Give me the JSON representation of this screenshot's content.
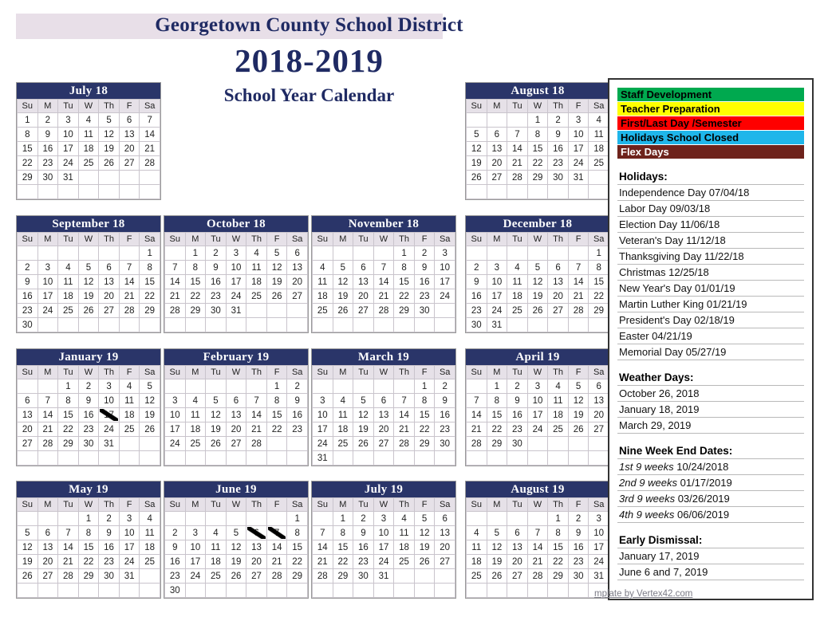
{
  "header": {
    "district": "Georgetown County School District",
    "year": "2018-2019",
    "subtitle": "School Year Calendar"
  },
  "weekday_headers": [
    "Su",
    "M",
    "Tu",
    "W",
    "Th",
    "F",
    "Sa"
  ],
  "colors": {
    "staff_development": "#00a94f",
    "teacher_preparation": "#ffff00",
    "first_last_day": "#fe0000",
    "holidays_closed": "#1fb6ea",
    "holidays_closed_light": "#9dd4e0",
    "flex_days": "#6e231c",
    "month_header": "#2a3569",
    "weekend_cell": "#e6e1e8",
    "title_band": "#e8dfe8",
    "title_text": "#1f2a63"
  },
  "months": [
    {
      "name": "July 18",
      "first_weekday": 0,
      "days": 31,
      "highlights": {
        "4": "cyan"
      }
    },
    {
      "name": "August 18",
      "first_weekday": 3,
      "days": 31,
      "highlights": {
        "15": "green",
        "16": "green",
        "17": "green",
        "20": "yellow",
        "21": "yellow",
        "22": "red"
      }
    },
    {
      "name": "September 18",
      "first_weekday": 6,
      "days": 30,
      "highlights": {
        "3": "cyan"
      }
    },
    {
      "name": "October 18",
      "first_weekday": 1,
      "days": 31,
      "highlights": {
        "26": "green"
      }
    },
    {
      "name": "November 18",
      "first_weekday": 4,
      "days": 30,
      "highlights": {
        "6": "cyan",
        "12": "cyan",
        "21": "lcyan",
        "22": "cyan",
        "23": "lcyan"
      }
    },
    {
      "name": "December 18",
      "first_weekday": 6,
      "days": 31,
      "highlights": {
        "20": "lcyan",
        "21": "lcyan",
        "24": "lcyan",
        "25": "cyan",
        "26": "lcyan",
        "27": "lcyan",
        "28": "lcyan",
        "31": "lcyan"
      }
    },
    {
      "name": "January 19",
      "first_weekday": 2,
      "days": 31,
      "highlights": {
        "1": "cyan",
        "2": "lcyan",
        "17": "red slash",
        "18": "green",
        "21": "cyan"
      }
    },
    {
      "name": "February 19",
      "first_weekday": 5,
      "days": 28,
      "highlights": {
        "18": "cyan"
      }
    },
    {
      "name": "March 19",
      "first_weekday": 5,
      "days": 31,
      "highlights": {
        "29": "yellow"
      }
    },
    {
      "name": "April 19",
      "first_weekday": 1,
      "days": 30,
      "highlights": {
        "19": "brown",
        "22": "lcyan",
        "23": "lcyan",
        "24": "lcyan",
        "25": "lcyan",
        "26": "lcyan"
      }
    },
    {
      "name": "May 19",
      "first_weekday": 3,
      "days": 31,
      "highlights": {
        "27": "cyan"
      }
    },
    {
      "name": "June 19",
      "first_weekday": 6,
      "days": 30,
      "highlights": {
        "6": "slash",
        "7": "red slash",
        "8": "brown"
      }
    },
    {
      "name": "July 19",
      "first_weekday": 1,
      "days": 31,
      "highlights": {}
    },
    {
      "name": "August 19",
      "first_weekday": 4,
      "days": 31,
      "highlights": {}
    }
  ],
  "legend": {
    "keys": [
      {
        "label": "Staff Development",
        "color_class": "key-green"
      },
      {
        "label": "Teacher Preparation",
        "color_class": "key-yellow"
      },
      {
        "label": "First/Last Day /Semester",
        "color_class": "key-red"
      },
      {
        "label": "Holidays School Closed",
        "color_class": "key-cyan"
      },
      {
        "label": "Flex Days",
        "color_class": "key-brown"
      }
    ],
    "holidays": {
      "heading": "Holidays:",
      "items": [
        "Independence Day 07/04/18",
        "Labor Day 09/03/18",
        "Election Day 11/06/18",
        "Veteran's Day 11/12/18",
        "Thanksgiving Day 11/22/18",
        "Christmas 12/25/18",
        "New Year's Day 01/01/19",
        "Martin Luther King 01/21/19",
        "President's Day 02/18/19",
        "Easter 04/21/19",
        "Memorial Day 05/27/19"
      ]
    },
    "weather_days": {
      "heading": "Weather Days:",
      "items": [
        "October 26, 2018",
        "January 18, 2019",
        "March 29, 2019"
      ]
    },
    "nine_week_end_dates": {
      "heading": "Nine Week End Dates:",
      "items": [
        {
          "label": "1st 9 weeks",
          "date": "10/24/2018"
        },
        {
          "label": "2nd 9 weeks",
          "date": "01/17/2019"
        },
        {
          "label": "3rd 9 weeks",
          "date": "03/26/2019"
        },
        {
          "label": "4th 9 weeks",
          "date": "06/06/2019"
        }
      ]
    },
    "early_dismissal": {
      "heading": "Early Dismissal:",
      "items": [
        "January 17, 2019",
        "June 6 and 7, 2019"
      ]
    }
  },
  "watermark": "mplate by Vertex42.com"
}
